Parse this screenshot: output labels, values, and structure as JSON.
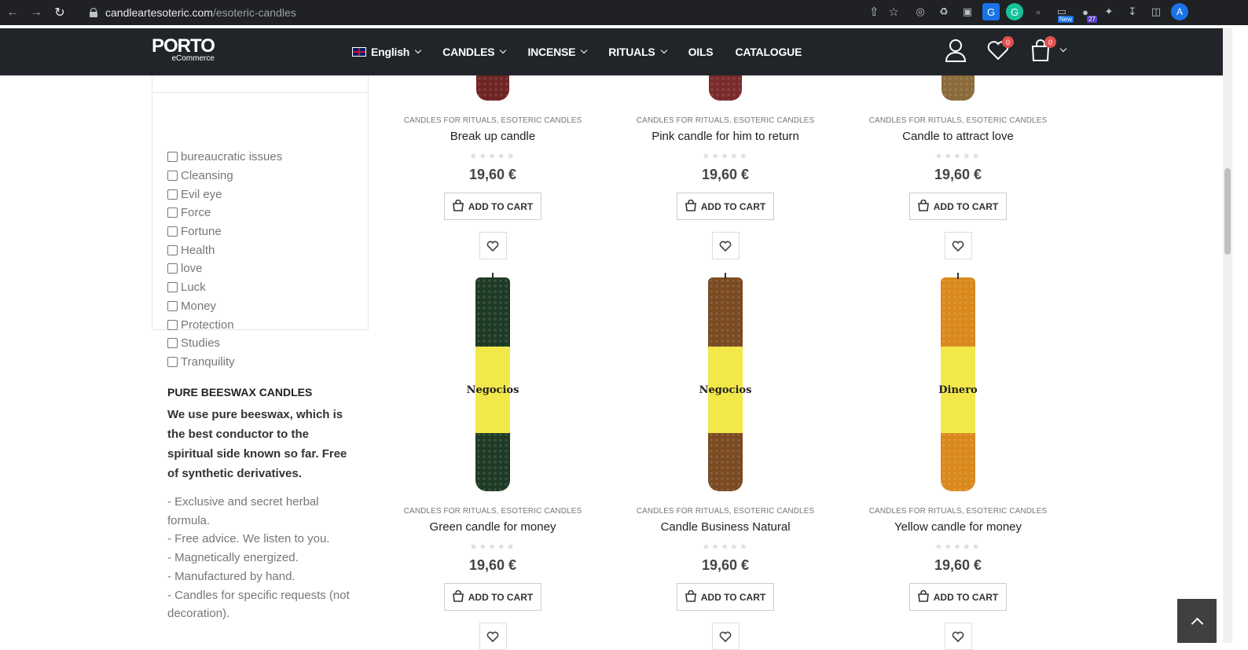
{
  "browser": {
    "url_domain": "candleartesoteric.com",
    "url_path": "/esoteric-candles",
    "extension_badge_new": "New",
    "extension_badge_count": "27",
    "profile_initial": "A"
  },
  "header": {
    "logo_main": "PORTO",
    "logo_sub": "eCommerce",
    "nav": [
      {
        "label": "English"
      },
      {
        "label": "CANDLES"
      },
      {
        "label": "INCENSE"
      },
      {
        "label": "RITUALS"
      },
      {
        "label": "OILS"
      },
      {
        "label": "CATALOGUE"
      }
    ],
    "wishlist_count": "0",
    "cart_count": "0"
  },
  "sidebar": {
    "filters": [
      "bureaucratic issues",
      "Cleansing",
      "Evil eye",
      "Force",
      "Fortune",
      "Health",
      "love",
      "Luck",
      "Money",
      "Protection",
      "Studies",
      "Tranquility"
    ],
    "promo_title": "PURE BEESWAX CANDLES",
    "promo_bold": "We use pure beeswax, which is the best conductor to the spiritual side known so far. Free of synthetic derivatives.",
    "promo_lines": [
      "- Exclusive and secret herbal formula.",
      "- Free advice. We listen to you.",
      "- Magnetically energized.",
      "- Manufactured by hand.",
      "- Candles for specific requests (not decoration)."
    ]
  },
  "products": [
    {
      "category": "CANDLES FOR RITUALS, ESOTERIC CANDLES",
      "title": "Break up candle",
      "price": "19,60 €",
      "add_label": "ADD TO CART",
      "color": "#6e2424"
    },
    {
      "category": "CANDLES FOR RITUALS, ESOTERIC CANDLES",
      "title": "Pink candle for him to return",
      "price": "19,60 €",
      "add_label": "ADD TO CART",
      "color": "#7a2a2a"
    },
    {
      "category": "CANDLES FOR RITUALS, ESOTERIC CANDLES",
      "title": "Candle to attract love",
      "price": "19,60 €",
      "add_label": "ADD TO CART",
      "color": "#8a6a3a"
    },
    {
      "category": "CANDLES FOR RITUALS, ESOTERIC CANDLES",
      "title": "Green candle for money",
      "price": "19,60 €",
      "add_label": "ADD TO CART",
      "color": "#1f3a24",
      "label": "Negocios"
    },
    {
      "category": "CANDLES FOR RITUALS, ESOTERIC CANDLES",
      "title": "Candle Business Natural",
      "price": "19,60 €",
      "add_label": "ADD TO CART",
      "color": "#7a4a22",
      "label": "Negocios"
    },
    {
      "category": "CANDLES FOR RITUALS, ESOTERIC CANDLES",
      "title": "Yellow candle for money",
      "price": "19,60 €",
      "add_label": "ADD TO CART",
      "color": "#d9891c",
      "label": "Dinero"
    }
  ],
  "stars_text": "★★★★★"
}
